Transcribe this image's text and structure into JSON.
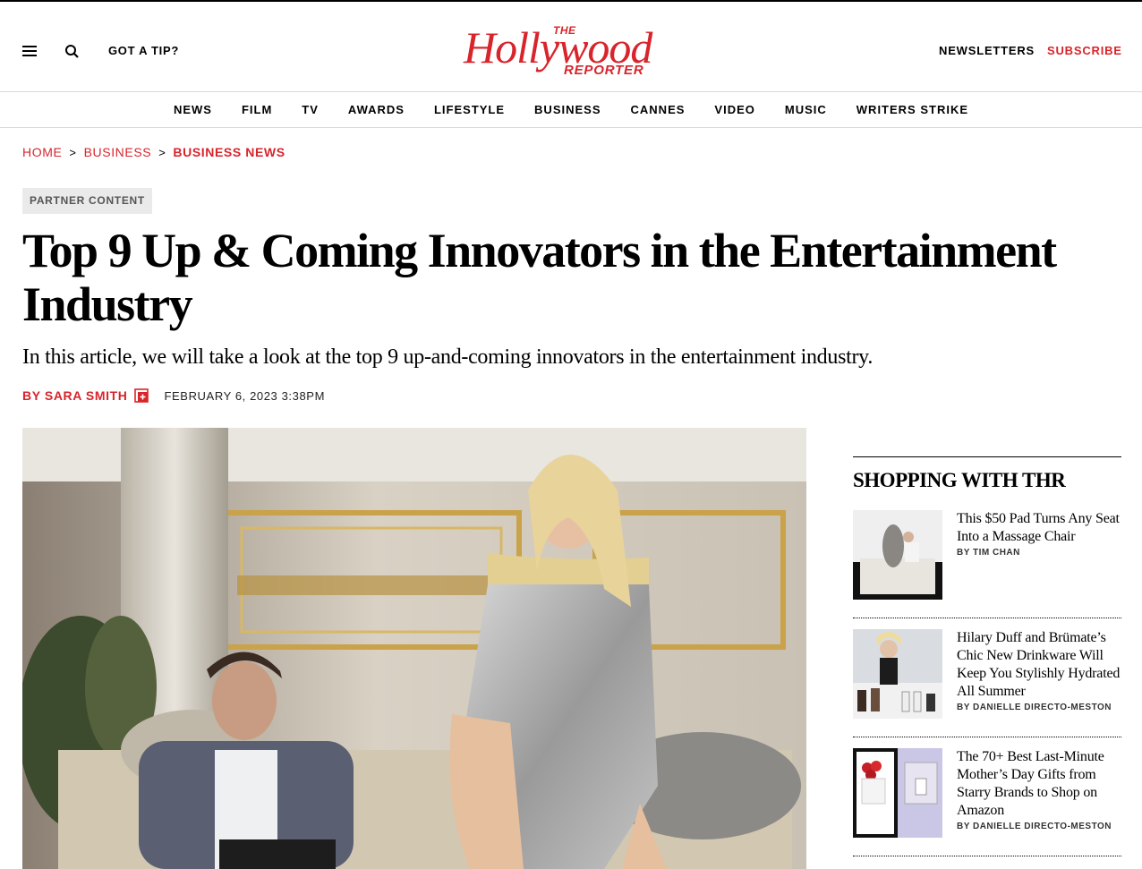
{
  "header": {
    "tip_label": "GOT A TIP?",
    "logo_the": "THE",
    "logo_main": "Hollywood",
    "logo_reporter": "REPORTER",
    "newsletters_label": "NEWSLETTERS",
    "subscribe_label": "SUBSCRIBE",
    "accent_color": "#d8242b"
  },
  "nav": {
    "items": [
      "NEWS",
      "FILM",
      "TV",
      "AWARDS",
      "LIFESTYLE",
      "BUSINESS",
      "CANNES",
      "VIDEO",
      "MUSIC",
      "WRITERS STRIKE"
    ]
  },
  "breadcrumb": {
    "items": [
      "HOME",
      "BUSINESS",
      "BUSINESS NEWS"
    ],
    "separator": ">"
  },
  "article": {
    "badge": "PARTNER CONTENT",
    "headline": "Top 9 Up & Coming Innovators in the Entertainment Industry",
    "dek": "In this article, we will take a look at the top 9 up-and-coming innovators in the entertainment industry.",
    "byline": "BY SARA SMITH",
    "date": "FEBRUARY 6, 2023 3:38PM"
  },
  "sidebar": {
    "title": "SHOPPING WITH THR",
    "cards": [
      {
        "title": "This $50 Pad Turns Any Seat Into a Massage Chair",
        "author": "BY TIM CHAN"
      },
      {
        "title": "Hilary Duff and Brümate’s Chic New Drinkware Will Keep You Stylishly Hydrated All Summer",
        "author": "BY DANIELLE DIRECTO-MESTON"
      },
      {
        "title": "The 70+ Best Last-Minute Mother’s Day Gifts from Starry Brands to Shop on Amazon",
        "author": "BY DANIELLE DIRECTO-MESTON"
      }
    ]
  }
}
